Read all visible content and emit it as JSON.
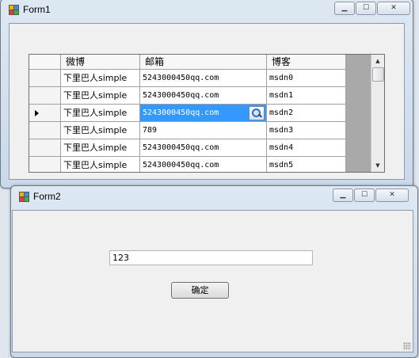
{
  "form1": {
    "title": "Form1",
    "controls": {
      "minimize": "▁",
      "maximize": "☐",
      "close": "✕"
    },
    "grid": {
      "columns": [
        "微博",
        "邮箱",
        "博客"
      ],
      "rows": [
        {
          "weibo": "下里巴人simple",
          "email": "5243000450qq.com",
          "blog": "msdn0"
        },
        {
          "weibo": "下里巴人simple",
          "email": "5243000450qq.com",
          "blog": "msdn1"
        },
        {
          "weibo": "下里巴人simple",
          "email": "5243000450qq.com",
          "blog": "msdn2"
        },
        {
          "weibo": "下里巴人simple",
          "email": "789",
          "blog": "msdn3"
        },
        {
          "weibo": "下里巴人simple",
          "email": "5243000450qq.com",
          "blog": "msdn4"
        },
        {
          "weibo": "下里巴人simple",
          "email": "5243000450qq.com",
          "blog": "msdn5"
        }
      ],
      "current_row": 2,
      "selected_cell": "email",
      "scroll": {
        "up": "▲",
        "down": "▼"
      }
    }
  },
  "form2": {
    "title": "Form2",
    "controls": {
      "minimize": "▁",
      "maximize": "☐",
      "close": "✕"
    },
    "textbox_value": "123",
    "ok_button": "确定"
  }
}
